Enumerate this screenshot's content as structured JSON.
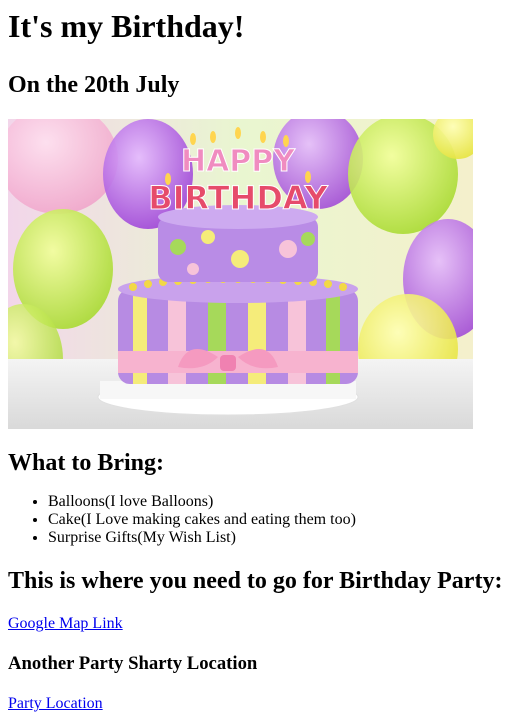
{
  "title": "It's my Birthday!",
  "date_heading": "On the 20th July",
  "image": {
    "alt_description": "birthday-cake",
    "cake_topper_top": "HAPPY",
    "cake_topper_bottom": "BIRTHDAY"
  },
  "bring_heading": "What to Bring:",
  "bring_items": [
    "Balloons(I love Balloons)",
    "Cake(I Love making cakes and eating them too)",
    "Surprise Gifts(My Wish List)"
  ],
  "where_heading": "This is where you need to go for Birthday Party:",
  "map_link": "Google Map Link",
  "another_heading": "Another Party Sharty Location",
  "party_link": "Party Location",
  "colors": {
    "link": "#0000ee"
  }
}
